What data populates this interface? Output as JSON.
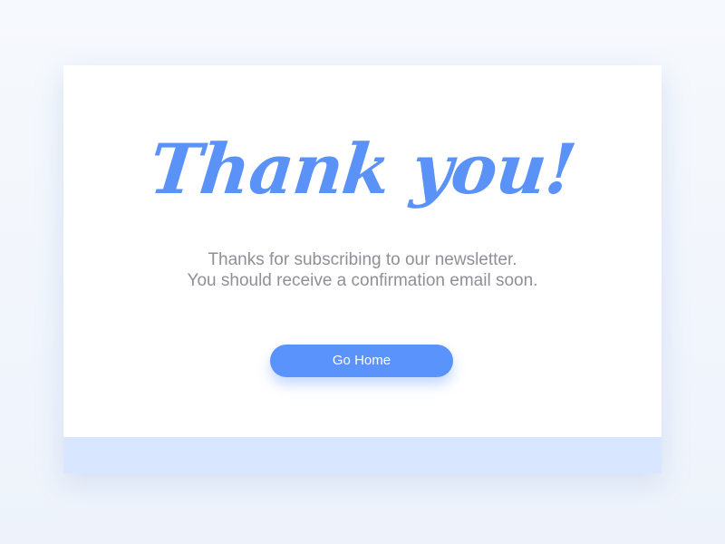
{
  "card": {
    "title": "Thank you!",
    "message_line1": "Thanks for subscribing to our newsletter.",
    "message_line2": "You should receive a confirmation email soon.",
    "button_label": "Go Home"
  },
  "colors": {
    "accent": "#5A93FB",
    "title": "#5B92F7",
    "text_muted": "#8F8F97",
    "card_bg": "#FFFFFF",
    "footer_bg": "#D9E6FF",
    "page_bg": "#F1F5FC"
  }
}
